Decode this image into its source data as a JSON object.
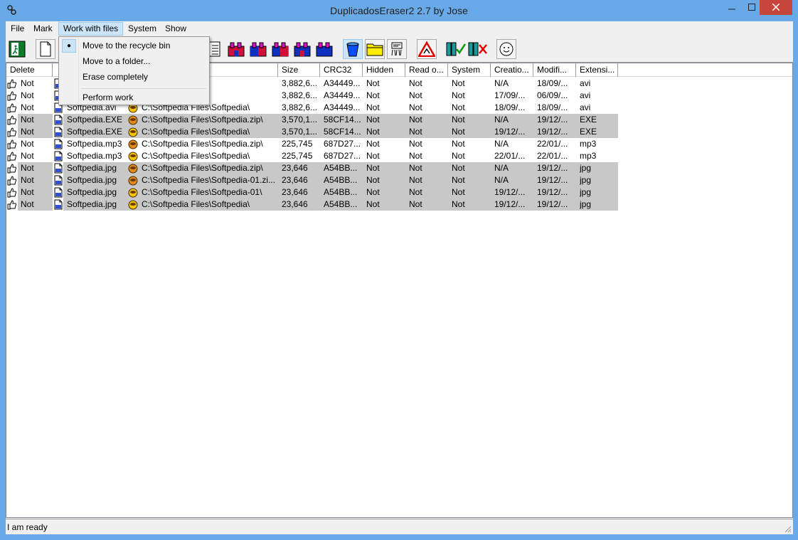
{
  "window": {
    "title": "DuplicadosEraser2 2.7 by Jose"
  },
  "menu": [
    "File",
    "Mark",
    "Work with files",
    "System",
    "Show"
  ],
  "dropdown": {
    "items": [
      "Move to the recycle bin",
      "Move to a folder...",
      "Erase completely",
      "Perform work"
    ],
    "checked_index": 0
  },
  "columns": [
    "Delete",
    "",
    "",
    "Size",
    "CRC32",
    "Hidden",
    "Read o...",
    "System",
    "Creatio...",
    "Modifi...",
    "Extensi..."
  ],
  "rows": [
    {
      "delete": "Not",
      "name": "",
      "path": "Softpedia.zip\\",
      "size": "3,882,6...",
      "crc": "A34449...",
      "hidden": "Not",
      "read": "Not",
      "system": "Not",
      "created": "N/A",
      "modified": "18/09/...",
      "ext": "avi",
      "grey": false,
      "icon": "orange"
    },
    {
      "delete": "Not",
      "name": "",
      "path": "",
      "size": "3,882,6...",
      "crc": "A34449...",
      "hidden": "Not",
      "read": "Not",
      "system": "Not",
      "created": "17/09/...",
      "modified": "06/09/...",
      "ext": "avi",
      "grey": false,
      "icon": "orange"
    },
    {
      "delete": "Not",
      "name": "Softpedia.avi",
      "path": "C:\\Softpedia Files\\Softpedia\\",
      "size": "3,882,6...",
      "crc": "A34449...",
      "hidden": "Not",
      "read": "Not",
      "system": "Not",
      "created": "18/09/...",
      "modified": "18/09/...",
      "ext": "avi",
      "grey": false,
      "icon": "yellow"
    },
    {
      "delete": "Not",
      "name": "Softpedia.EXE",
      "path": "C:\\Softpedia Files\\Softpedia.zip\\",
      "size": "3,570,1...",
      "crc": "58CF14...",
      "hidden": "Not",
      "read": "Not",
      "system": "Not",
      "created": "N/A",
      "modified": "19/12/...",
      "ext": "EXE",
      "grey": true,
      "icon": "orange"
    },
    {
      "delete": "Not",
      "name": "Softpedia.EXE",
      "path": "C:\\Softpedia Files\\Softpedia\\",
      "size": "3,570,1...",
      "crc": "58CF14...",
      "hidden": "Not",
      "read": "Not",
      "system": "Not",
      "created": "19/12/...",
      "modified": "19/12/...",
      "ext": "EXE",
      "grey": true,
      "icon": "yellow"
    },
    {
      "delete": "Not",
      "name": "Softpedia.mp3",
      "path": "C:\\Softpedia Files\\Softpedia.zip\\",
      "size": "225,745",
      "crc": "687D27...",
      "hidden": "Not",
      "read": "Not",
      "system": "Not",
      "created": "N/A",
      "modified": "22/01/...",
      "ext": "mp3",
      "grey": false,
      "icon": "orange"
    },
    {
      "delete": "Not",
      "name": "Softpedia.mp3",
      "path": "C:\\Softpedia Files\\Softpedia\\",
      "size": "225,745",
      "crc": "687D27...",
      "hidden": "Not",
      "read": "Not",
      "system": "Not",
      "created": "22/01/...",
      "modified": "22/01/...",
      "ext": "mp3",
      "grey": false,
      "icon": "yellow"
    },
    {
      "delete": "Not",
      "name": "Softpedia.jpg",
      "path": "C:\\Softpedia Files\\Softpedia.zip\\",
      "size": "23,646",
      "crc": "A54BB...",
      "hidden": "Not",
      "read": "Not",
      "system": "Not",
      "created": "N/A",
      "modified": "19/12/...",
      "ext": "jpg",
      "grey": true,
      "icon": "orange"
    },
    {
      "delete": "Not",
      "name": "Softpedia.jpg",
      "path": "C:\\Softpedia Files\\Softpedia-01.zi...",
      "size": "23,646",
      "crc": "A54BB...",
      "hidden": "Not",
      "read": "Not",
      "system": "Not",
      "created": "N/A",
      "modified": "19/12/...",
      "ext": "jpg",
      "grey": true,
      "icon": "orange"
    },
    {
      "delete": "Not",
      "name": "Softpedia.jpg",
      "path": "C:\\Softpedia Files\\Softpedia-01\\",
      "size": "23,646",
      "crc": "A54BB...",
      "hidden": "Not",
      "read": "Not",
      "system": "Not",
      "created": "19/12/...",
      "modified": "19/12/...",
      "ext": "jpg",
      "grey": true,
      "icon": "yellow"
    },
    {
      "delete": "Not",
      "name": "Softpedia.jpg",
      "path": "C:\\Softpedia Files\\Softpedia\\",
      "size": "23,646",
      "crc": "A54BB...",
      "hidden": "Not",
      "read": "Not",
      "system": "Not",
      "created": "19/12/...",
      "modified": "19/12/...",
      "ext": "jpg",
      "grey": true,
      "icon": "yellow"
    }
  ],
  "status": "I am ready"
}
